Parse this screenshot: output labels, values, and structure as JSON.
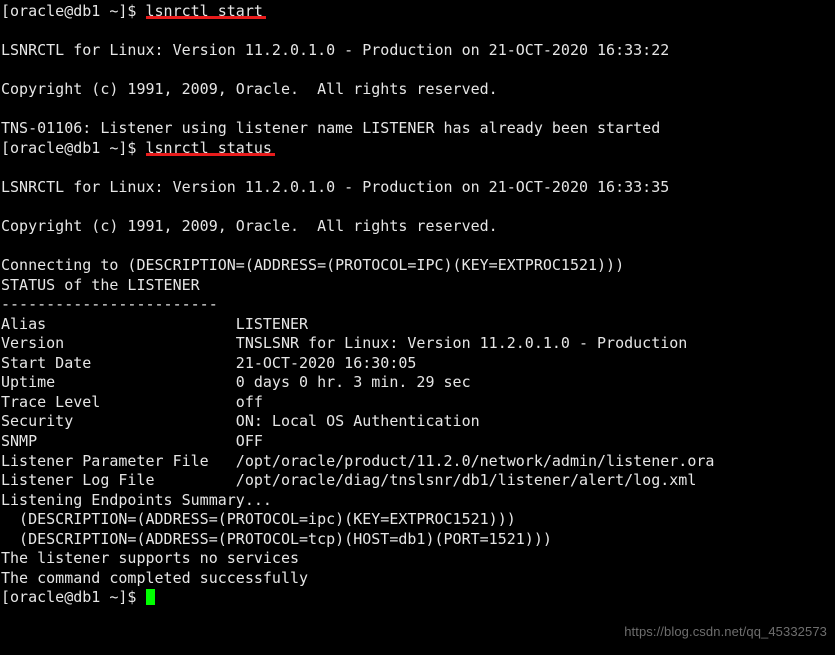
{
  "terminal": {
    "background_color": "#000000",
    "foreground_color": "#e6e6e6",
    "cursor_color": "#00ff00",
    "highlight_color": "#e81c1c",
    "prompt": "[oracle@db1 ~]$ ",
    "lines": [
      {
        "type": "prompt",
        "prompt": "[oracle@db1 ~]$ ",
        "command": "lsnrctl start",
        "underlined": true
      },
      {
        "type": "blank",
        "text": ""
      },
      {
        "type": "output",
        "text": "LSNRCTL for Linux: Version 11.2.0.1.0 - Production on 21-OCT-2020 16:33:22"
      },
      {
        "type": "blank",
        "text": ""
      },
      {
        "type": "output",
        "text": "Copyright (c) 1991, 2009, Oracle.  All rights reserved."
      },
      {
        "type": "blank",
        "text": ""
      },
      {
        "type": "output",
        "text": "TNS-01106: Listener using listener name LISTENER has already been started"
      },
      {
        "type": "prompt",
        "prompt": "[oracle@db1 ~]$ ",
        "command": "lsnrctl status",
        "underlined": true
      },
      {
        "type": "blank",
        "text": ""
      },
      {
        "type": "output",
        "text": "LSNRCTL for Linux: Version 11.2.0.1.0 - Production on 21-OCT-2020 16:33:35"
      },
      {
        "type": "blank",
        "text": ""
      },
      {
        "type": "output",
        "text": "Copyright (c) 1991, 2009, Oracle.  All rights reserved."
      },
      {
        "type": "blank",
        "text": ""
      },
      {
        "type": "output",
        "text": "Connecting to (DESCRIPTION=(ADDRESS=(PROTOCOL=IPC)(KEY=EXTPROC1521)))"
      },
      {
        "type": "output",
        "text": "STATUS of the LISTENER"
      },
      {
        "type": "output",
        "text": "------------------------"
      },
      {
        "type": "output",
        "text": "Alias                     LISTENER"
      },
      {
        "type": "output",
        "text": "Version                   TNSLSNR for Linux: Version 11.2.0.1.0 - Production"
      },
      {
        "type": "output",
        "text": "Start Date                21-OCT-2020 16:30:05"
      },
      {
        "type": "output",
        "text": "Uptime                    0 days 0 hr. 3 min. 29 sec"
      },
      {
        "type": "output",
        "text": "Trace Level               off"
      },
      {
        "type": "output",
        "text": "Security                  ON: Local OS Authentication"
      },
      {
        "type": "output",
        "text": "SNMP                      OFF"
      },
      {
        "type": "output",
        "text": "Listener Parameter File   /opt/oracle/product/11.2.0/network/admin/listener.ora"
      },
      {
        "type": "output",
        "text": "Listener Log File         /opt/oracle/diag/tnslsnr/db1/listener/alert/log.xml"
      },
      {
        "type": "output",
        "text": "Listening Endpoints Summary..."
      },
      {
        "type": "output",
        "text": "  (DESCRIPTION=(ADDRESS=(PROTOCOL=ipc)(KEY=EXTPROC1521)))"
      },
      {
        "type": "output",
        "text": "  (DESCRIPTION=(ADDRESS=(PROTOCOL=tcp)(HOST=db1)(PORT=1521)))"
      },
      {
        "type": "output",
        "text": "The listener supports no services"
      },
      {
        "type": "output",
        "text": "The command completed successfully"
      },
      {
        "type": "prompt_cursor",
        "prompt": "[oracle@db1 ~]$ ",
        "command": "",
        "underlined": false
      }
    ],
    "status_fields": [
      {
        "label": "Alias",
        "value": "LISTENER"
      },
      {
        "label": "Version",
        "value": "TNSLSNR for Linux: Version 11.2.0.1.0 - Production"
      },
      {
        "label": "Start Date",
        "value": "21-OCT-2020 16:30:05"
      },
      {
        "label": "Uptime",
        "value": "0 days 0 hr. 3 min. 29 sec"
      },
      {
        "label": "Trace Level",
        "value": "off"
      },
      {
        "label": "Security",
        "value": "ON: Local OS Authentication"
      },
      {
        "label": "SNMP",
        "value": "OFF"
      },
      {
        "label": "Listener Parameter File",
        "value": "/opt/oracle/product/11.2.0/network/admin/listener.ora"
      },
      {
        "label": "Listener Log File",
        "value": "/opt/oracle/diag/tnslsnr/db1/listener/alert/log.xml"
      }
    ]
  },
  "watermark": {
    "text": "https://blog.csdn.net/qq_45332573"
  }
}
